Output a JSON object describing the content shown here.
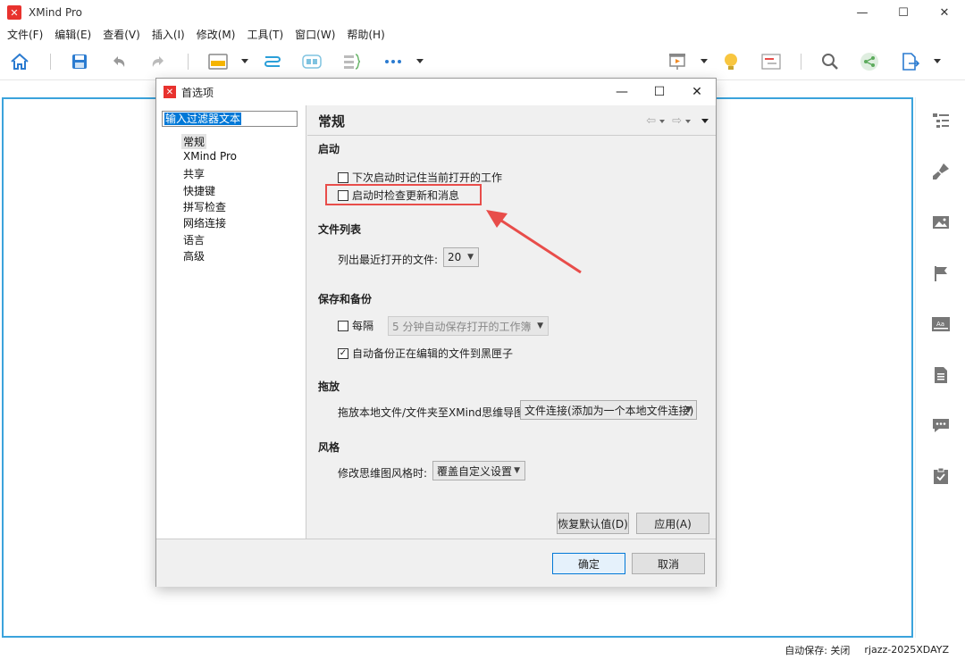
{
  "app": {
    "title": "XMind Pro",
    "logo_glyph": "✕"
  },
  "window_controls": {
    "minimize": "—",
    "maximize": "☐",
    "close": "✕"
  },
  "menu": [
    "文件(F)",
    "编辑(E)",
    "查看(V)",
    "插入(I)",
    "修改(M)",
    "工具(T)",
    "窗口(W)",
    "帮助(H)"
  ],
  "toolbar_icons": [
    "home-icon",
    "save-icon",
    "undo-icon",
    "redo-icon",
    "topic-icon",
    "relationship-icon",
    "boundary-icon",
    "summary-icon",
    "more-icon",
    "presentation-icon",
    "brainstorm-icon",
    "gantt-icon",
    "search-icon",
    "share-icon",
    "export-icon"
  ],
  "right_panel_icons": [
    "outline-icon",
    "format-brush-icon",
    "image-icon",
    "marker-flag-icon",
    "notes-text-icon",
    "document-icon",
    "comment-icon",
    "task-icon"
  ],
  "status": {
    "autosave": "自动保存: 关闭",
    "user": "rjazz-2025XDAYZ"
  },
  "dialog": {
    "title": "首选项",
    "filter_placeholder": "输入过滤器文本",
    "nav": [
      "常规",
      "XMind Pro",
      "共享",
      "快捷键",
      "拼写检查",
      "网络连接",
      "语言",
      "高级"
    ],
    "page_title": "常规",
    "startup": {
      "title": "启动",
      "remember_label": "下次启动时记住当前打开的工作",
      "remember_checked": false,
      "check_updates_label": "启动时检查更新和消息",
      "check_updates_checked": false
    },
    "file_list": {
      "title": "文件列表",
      "recent_label": "列出最近打开的文件:",
      "recent_value": "20"
    },
    "save_backup": {
      "title": "保存和备份",
      "every_label": "每隔",
      "every_checked": false,
      "autosave_value": "5  分钟自动保存打开的工作簿",
      "backup_label": "自动备份正在编辑的文件到黑匣子",
      "backup_checked": true
    },
    "drag": {
      "title": "拖放",
      "label": "拖放本地文件/文件夹至XMind思维导图:",
      "value": "文件连接(添加为一个本地文件连接)"
    },
    "style": {
      "title": "风格",
      "label": "修改思维图风格时:",
      "value": "覆盖自定义设置"
    },
    "restore_defaults": "恢复默认值(D)",
    "apply": "应用(A)",
    "ok": "确定",
    "cancel": "取消"
  },
  "colors": {
    "accent": "#3ba3dc",
    "logo": "#e8322e",
    "highlight": "#e84d4a"
  }
}
